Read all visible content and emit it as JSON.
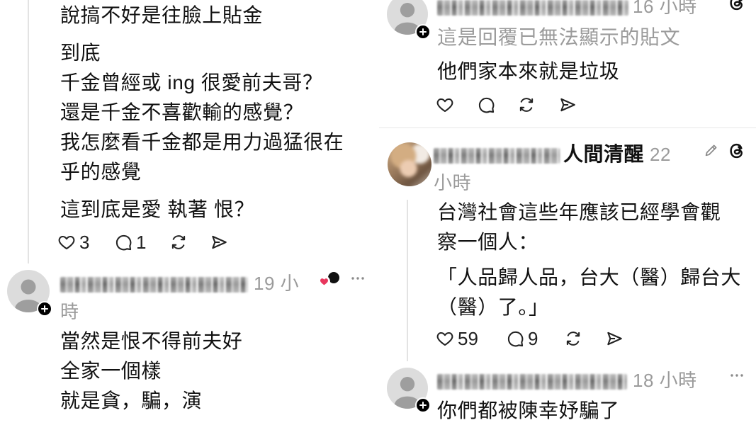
{
  "left_panel": {
    "post": {
      "paragraphs": [
        [
          "說搞不好是往臉上貼金"
        ],
        [
          "到底",
          "千金曾經或 ing 很愛前夫哥？",
          "還是千金不喜歡輸的感覺？",
          "我怎麼看千金都是用力過猛很在",
          "乎的感覺"
        ],
        [
          "這到底是愛 執著 恨？"
        ]
      ],
      "like_count": "3",
      "reply_count": "1"
    },
    "reply": {
      "timestamp": "19 小時",
      "body_lines": [
        "當然是恨不得前夫好",
        "全家一個樣",
        "就是貪，騙，演"
      ]
    }
  },
  "right_panel": {
    "reply_top": {
      "timestamp": "16 小時",
      "context_note": "這是回覆已無法顯示的貼文",
      "body_lines": [
        "他們家本來就是垃圾"
      ]
    },
    "reply_main": {
      "display_name": "人間清醒",
      "timestamp": "22 小時",
      "paragraphs": [
        [
          "台灣社會這些年應該已經學會觀",
          "察一個人："
        ],
        [
          "「人品歸人品，台大（醫）歸台大",
          "（醫）了。」"
        ]
      ],
      "like_count": "59",
      "reply_count": "9"
    },
    "reply_bottom": {
      "timestamp": "18 小時",
      "body_lines": [
        "你們都被陳幸妤騙了"
      ]
    }
  },
  "icons": {
    "like": "heart-icon",
    "reply": "comment-icon",
    "repost": "repost-icon",
    "share": "share-icon",
    "more": "more-icon",
    "threads": "threads-logo-icon",
    "edited": "pencil-icon",
    "follow": "plus-icon",
    "avatar": "default-avatar-icon"
  },
  "colors": {
    "text": "#111111",
    "muted": "#9b9b9b",
    "icon": "#222222",
    "divider": "#e6e6e6",
    "reaction_heart": "#e8365d"
  }
}
